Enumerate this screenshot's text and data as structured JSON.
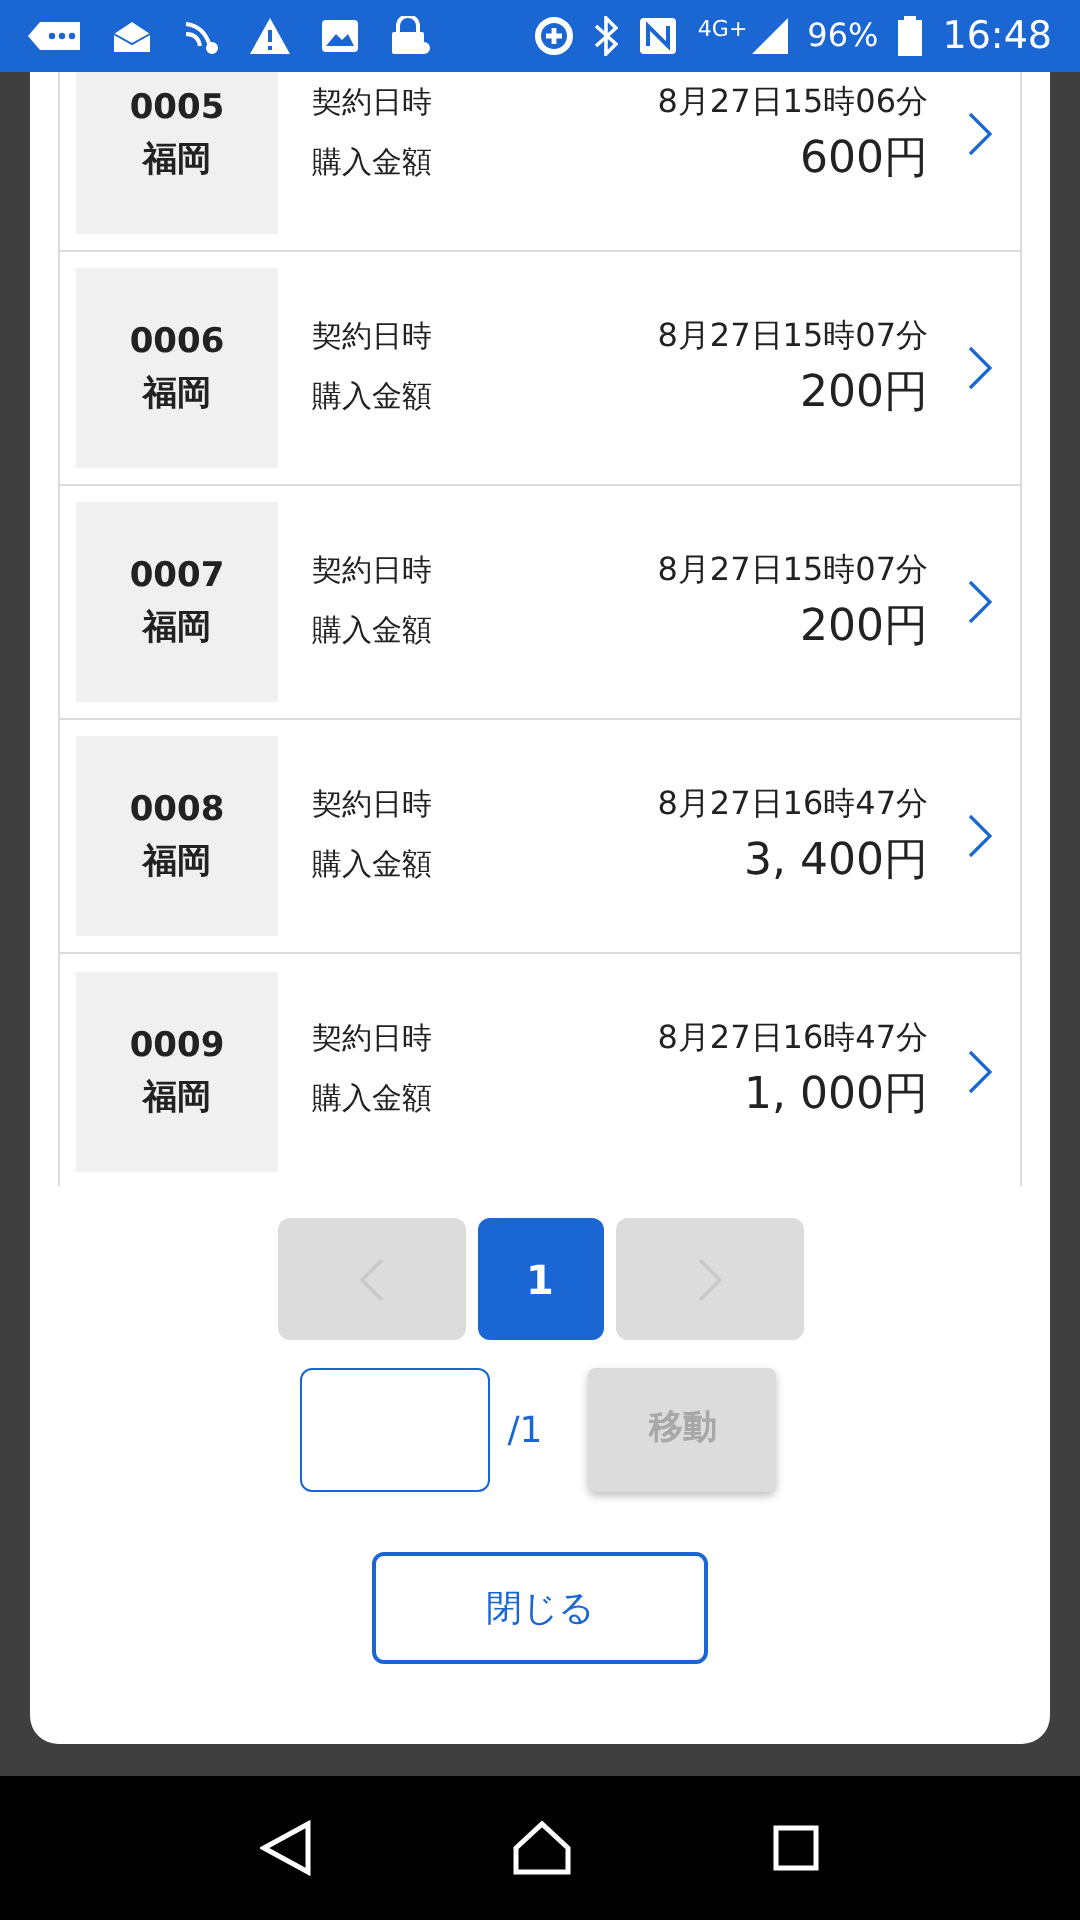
{
  "status_bar": {
    "network": "4G+",
    "battery": "96%",
    "time": "16:48"
  },
  "orders": [
    {
      "code": "0005",
      "place": "福岡",
      "date_label": "契約日時",
      "date": "8月27日15時06分",
      "amount_label": "購入金額",
      "amount": "600円"
    },
    {
      "code": "0006",
      "place": "福岡",
      "date_label": "契約日時",
      "date": "8月27日15時07分",
      "amount_label": "購入金額",
      "amount": "200円"
    },
    {
      "code": "0007",
      "place": "福岡",
      "date_label": "契約日時",
      "date": "8月27日15時07分",
      "amount_label": "購入金額",
      "amount": "200円"
    },
    {
      "code": "0008",
      "place": "福岡",
      "date_label": "契約日時",
      "date": "8月27日16時47分",
      "amount_label": "購入金額",
      "amount": "3, 400円"
    },
    {
      "code": "0009",
      "place": "福岡",
      "date_label": "契約日時",
      "date": "8月27日16時47分",
      "amount_label": "購入金額",
      "amount": "1, 000円"
    }
  ],
  "pagination": {
    "prev_disabled": true,
    "pages": [
      {
        "label": "1",
        "selected": true
      }
    ],
    "next_disabled": true
  },
  "jump": {
    "total": "/1",
    "button": "移動",
    "button_disabled": true
  },
  "close_button": "閉じる"
}
